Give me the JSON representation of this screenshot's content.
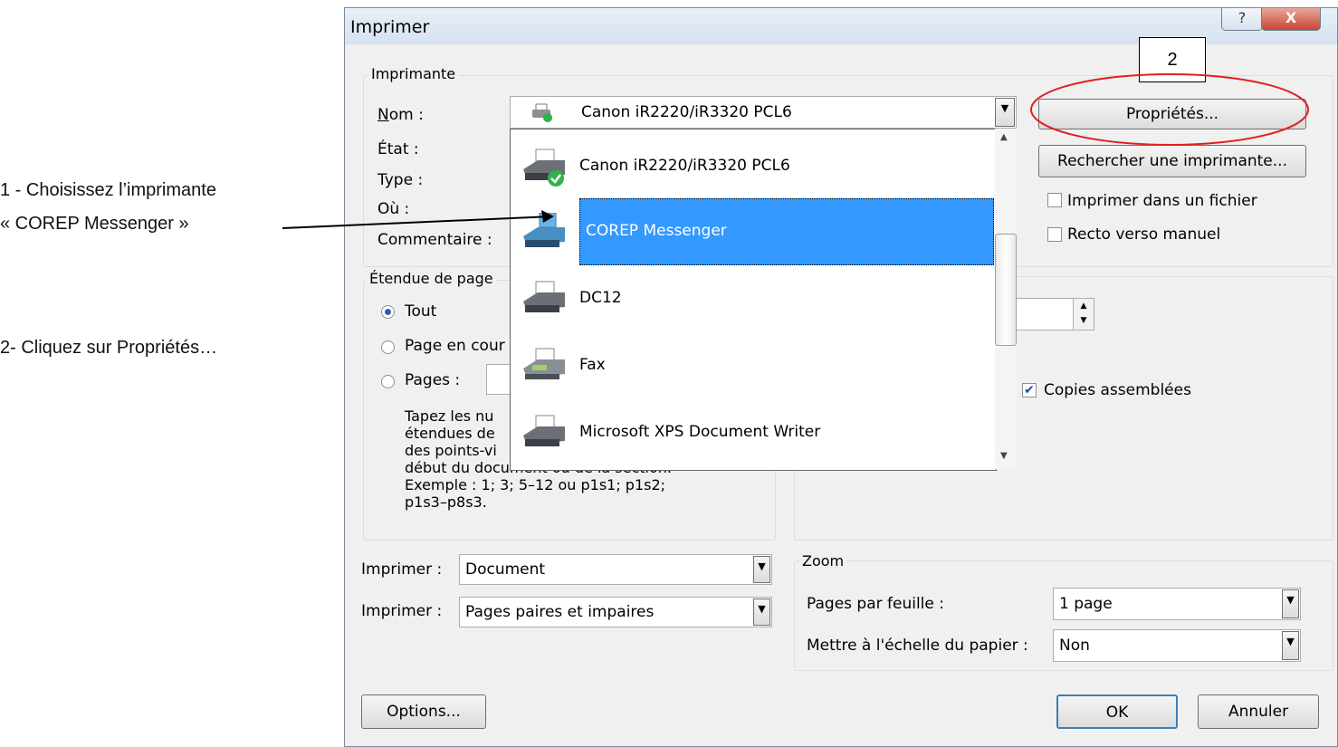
{
  "annotations": {
    "step1_line1": "1 - Choisissez l’imprimante",
    "step1_line2": "« COREP Messenger »",
    "step2": "2- Cliquez sur Propriétés…",
    "callout_number": "2"
  },
  "dialog": {
    "title": "Imprimer",
    "help_glyph": "?",
    "close_glyph": "X"
  },
  "printer_group": {
    "legend": "Imprimante",
    "name_label": "Nom :",
    "state_label": "État :",
    "type_label": "Type :",
    "where_label": "Où :",
    "comment_label": "Commentaire :",
    "selected_printer": "Canon iR2220/iR3320 PCL6",
    "properties_button": "Propriétés...",
    "find_printer_button": "Rechercher une imprimante...",
    "print_to_file": "Imprimer dans un fichier",
    "manual_duplex": "Recto verso manuel",
    "print_to_file_checked": false,
    "manual_duplex_checked": false
  },
  "printer_list": {
    "items": [
      {
        "name": "Canon iR2220/iR3320 PCL6",
        "icon": "printer-default-icon",
        "selected": false
      },
      {
        "name": "COREP Messenger",
        "icon": "printer-icon",
        "selected": true
      },
      {
        "name": "DC12",
        "icon": "printer-icon",
        "selected": false
      },
      {
        "name": "Fax",
        "icon": "fax-icon",
        "selected": false
      },
      {
        "name": "Microsoft XPS Document Writer",
        "icon": "printer-icon",
        "selected": false
      }
    ]
  },
  "page_range": {
    "legend": "Étendue de page",
    "all": "Tout",
    "current": "Page en cour",
    "pages": "Pages :",
    "help_lines": [
      "Tapez les nu",
      "étendues de",
      "des points-vi",
      "début du document ou de la section.",
      "Exemple : 1; 3; 5–12 ou p1s1; p1s2;",
      "p1s3–p8s3."
    ]
  },
  "copies": {
    "collate_label": "Copies assemblées",
    "collate_checked": true
  },
  "print_what": {
    "label1": "Imprimer :",
    "value1": "Document",
    "label2": "Imprimer :",
    "value2": "Pages paires et impaires"
  },
  "zoom": {
    "legend": "Zoom",
    "pages_per_sheet_label": "Pages par feuille :",
    "pages_per_sheet_value": "1 page",
    "scale_label": "Mettre à l'échelle du papier :",
    "scale_value": "Non"
  },
  "footer": {
    "options_button": "Options...",
    "ok_button": "OK",
    "cancel_button": "Annuler"
  },
  "colors": {
    "selection": "#3399ff",
    "annotation_circle": "#e02020"
  }
}
